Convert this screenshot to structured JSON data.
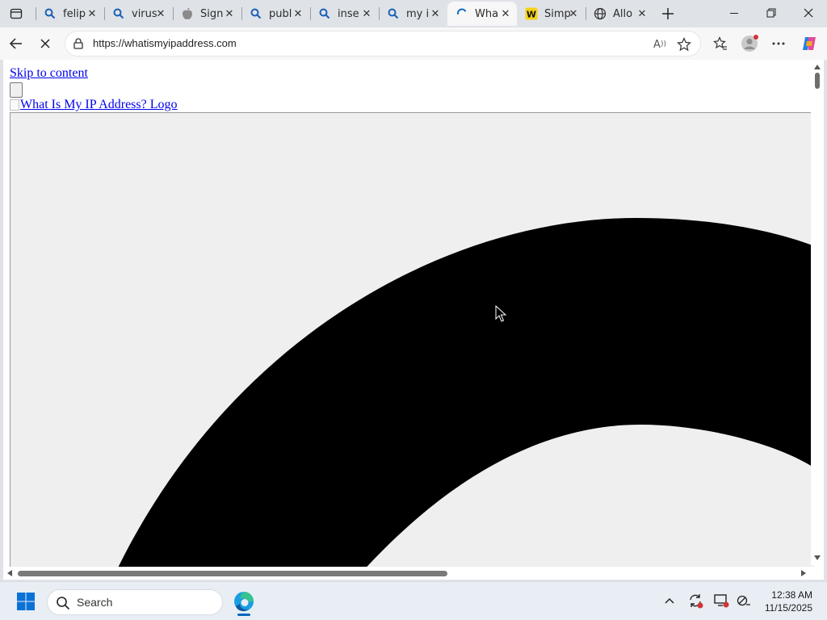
{
  "browser": {
    "tabs": [
      {
        "title": "felip",
        "icon": "search-icon",
        "active": false
      },
      {
        "title": "virus",
        "icon": "search-icon",
        "active": false
      },
      {
        "title": "Sign",
        "icon": "apple-icon",
        "active": false
      },
      {
        "title": "publ",
        "icon": "search-icon",
        "active": false
      },
      {
        "title": "inse",
        "icon": "search-icon",
        "active": false
      },
      {
        "title": "my i",
        "icon": "search-icon",
        "active": false
      },
      {
        "title": "Wha",
        "icon": "loading-spinner-icon",
        "active": true
      },
      {
        "title": "Simp",
        "icon": "w-logo-icon",
        "active": false
      },
      {
        "title": "Allo",
        "icon": "globe-icon",
        "active": false
      }
    ],
    "address_bar": {
      "url": "https://whatismyipaddress.com"
    },
    "colors": {
      "accent": "#0067c0",
      "link": "#0000ee",
      "favicon_yellow": "#f5d316"
    }
  },
  "page": {
    "skip_link": "Skip to content",
    "logo_alt": "What Is My IP Address? Logo"
  },
  "taskbar": {
    "search_label": "Search",
    "time": "12:38 AM",
    "date": "11/15/2025"
  }
}
